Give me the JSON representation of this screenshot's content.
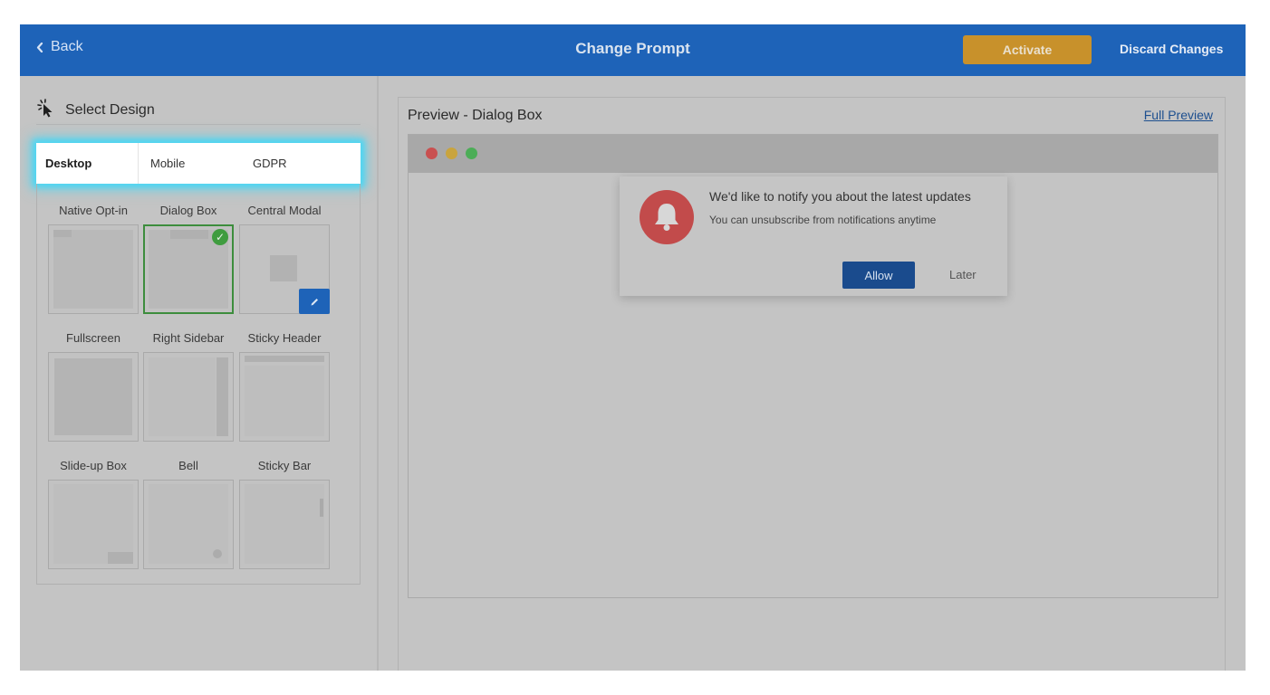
{
  "header": {
    "back_label": "Back",
    "title": "Change Prompt",
    "activate_label": "Activate",
    "discard_label": "Discard Changes"
  },
  "sidebar": {
    "heading": "Select Design",
    "tabs": [
      {
        "label": "Desktop",
        "active": true
      },
      {
        "label": "Mobile",
        "active": false
      },
      {
        "label": "GDPR",
        "active": false
      }
    ],
    "designs": [
      {
        "label": "Native Opt-in"
      },
      {
        "label": "Dialog Box",
        "selected": true
      },
      {
        "label": "Central Modal"
      },
      {
        "label": "Fullscreen"
      },
      {
        "label": "Right Sidebar"
      },
      {
        "label": "Sticky Header"
      },
      {
        "label": "Slide-up Box"
      },
      {
        "label": "Bell"
      },
      {
        "label": "Sticky Bar"
      }
    ]
  },
  "preview": {
    "title": "Preview - Dialog Box",
    "full_preview_label": "Full Preview",
    "dialog": {
      "title": "We'd like to notify you about the latest updates",
      "subtitle": "You can unsubscribe from notifications anytime",
      "allow_label": "Allow",
      "later_label": "Later"
    }
  },
  "colors": {
    "header_bg": "#1e63b8",
    "activate_bg": "#c8912b",
    "selected_border": "#3d8d3d",
    "tab_highlight": "#4fd6f2",
    "bell_red": "#c24b4b",
    "allow_bg": "#1a4b8d",
    "traffic_red": "#c95050",
    "traffic_yellow": "#c9a43e",
    "traffic_green": "#4cad57"
  }
}
